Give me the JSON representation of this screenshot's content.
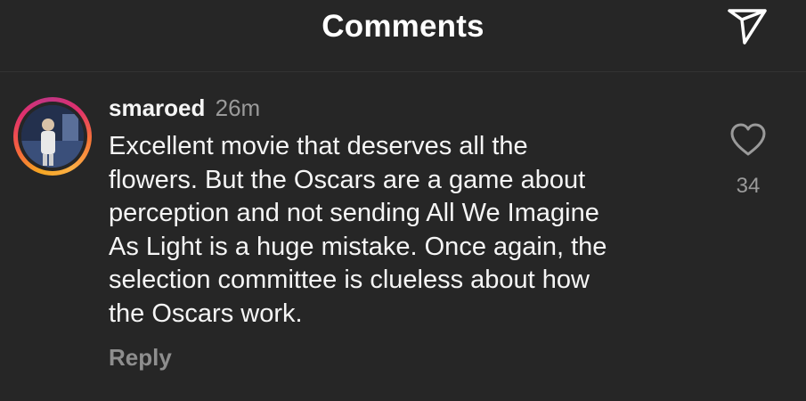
{
  "header": {
    "title": "Comments",
    "share_icon": "send-icon"
  },
  "comment": {
    "username": "smaroed",
    "timestamp": "26m",
    "text": "Excellent movie that deserves all the\nflowers. But the Oscars are a game about\nperception and not sending All We Imagine\nAs Light is a huge mistake. Once again, the\nselection committee is clueless about how\nthe Oscars work.",
    "reply_label": "Reply",
    "like_count": "34",
    "like_icon": "heart-icon",
    "avatar_story_ring": true
  },
  "colors": {
    "background": "#262626",
    "text": "#f5f5f5",
    "muted": "#9a9a9a"
  }
}
